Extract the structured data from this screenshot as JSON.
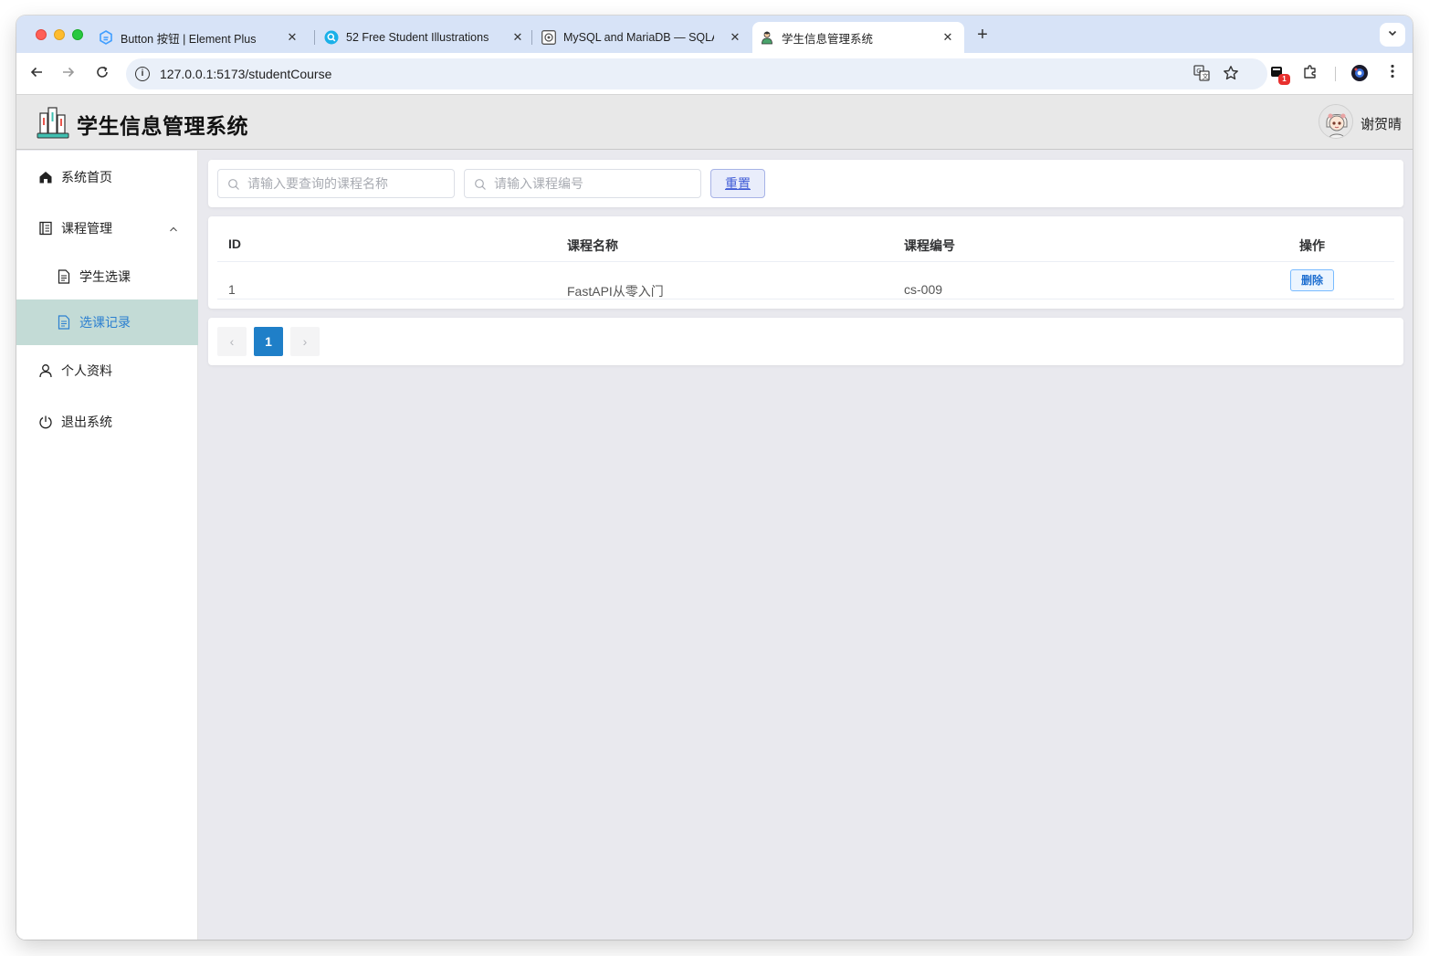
{
  "browser": {
    "tabs": [
      {
        "title": "Button 按钮 | Element Plus",
        "favicon": "element-plus-icon"
      },
      {
        "title": "52 Free Student Illustrations -",
        "favicon": "search-badge-icon"
      },
      {
        "title": "MySQL and MariaDB — SQLA",
        "favicon": "sqlalchemy-icon"
      },
      {
        "title": "学生信息管理系统",
        "favicon": "student-icon",
        "active": true
      }
    ],
    "url": "127.0.0.1:5173/studentCourse",
    "extension_badge": "1"
  },
  "app": {
    "title": "学生信息管理系统",
    "user": {
      "name": "谢贺晴"
    }
  },
  "sidebar": {
    "items": [
      {
        "label": "系统首页",
        "icon": "home-icon"
      },
      {
        "label": "课程管理",
        "icon": "book-icon",
        "expanded": true
      },
      {
        "label": "学生选课",
        "icon": "document-icon",
        "sub": true
      },
      {
        "label": "选课记录",
        "icon": "document-icon",
        "sub": true,
        "active": true
      },
      {
        "label": "个人资料",
        "icon": "user-icon"
      },
      {
        "label": "退出系统",
        "icon": "power-icon"
      }
    ]
  },
  "search": {
    "course_name_placeholder": "请输入要查询的课程名称",
    "course_no_placeholder": "请输入课程编号",
    "reset_label": "重置"
  },
  "table": {
    "headers": [
      "ID",
      "课程名称",
      "课程编号",
      "操作"
    ],
    "rows": [
      {
        "id": "1",
        "name": "FastAPI从零入门",
        "no": "cs-009",
        "action": "删除"
      }
    ]
  },
  "pagination": {
    "current": "1",
    "prev": "‹",
    "next": "›"
  },
  "colors": {
    "active_menu_bg": "#c3dbd6",
    "active_menu_text": "#2b7fd0",
    "page_current": "#1f7fc8"
  }
}
